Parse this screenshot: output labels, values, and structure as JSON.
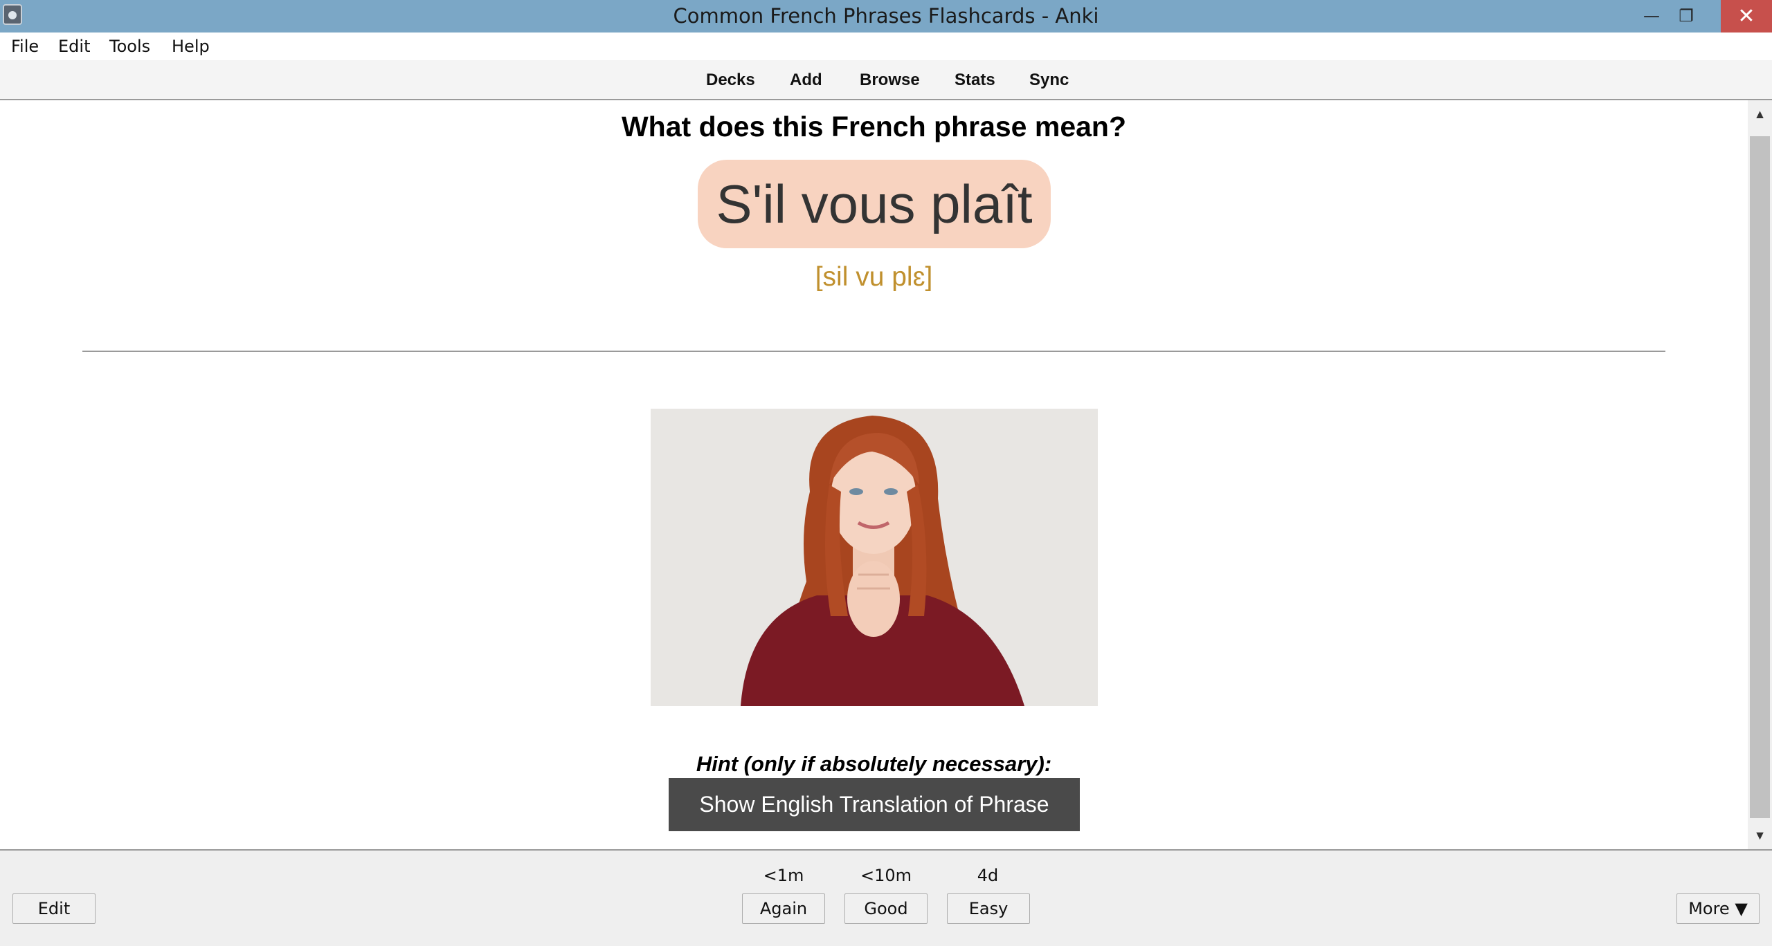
{
  "window": {
    "title": "Common French Phrases Flashcards - Anki",
    "minimize_glyph": "—",
    "maximize_glyph": "❐",
    "close_glyph": "✕"
  },
  "menu": {
    "file": "File",
    "edit": "Edit",
    "tools": "Tools",
    "help": "Help"
  },
  "toolbar": {
    "decks": "Decks",
    "add": "Add",
    "browse": "Browse",
    "stats": "Stats",
    "sync": "Sync"
  },
  "card": {
    "question": "What does this French phrase mean?",
    "phrase": "S'il vous plaît",
    "pronunciation": "[sil vu plɛ]",
    "pill_color": "#f8d3c0",
    "pronunciation_color": "#c0902e",
    "image_alt": "woman-pleading-photo",
    "hint_label": "Hint (only if absolutely necessary):",
    "hint_button": "Show English Translation of Phrase"
  },
  "bottom": {
    "edit_button": "Edit",
    "answers": [
      {
        "interval": "<1m",
        "label": "Again"
      },
      {
        "interval": "<10m",
        "label": "Good"
      },
      {
        "interval": "4d",
        "label": "Easy"
      }
    ],
    "more_button": "More ▼"
  }
}
